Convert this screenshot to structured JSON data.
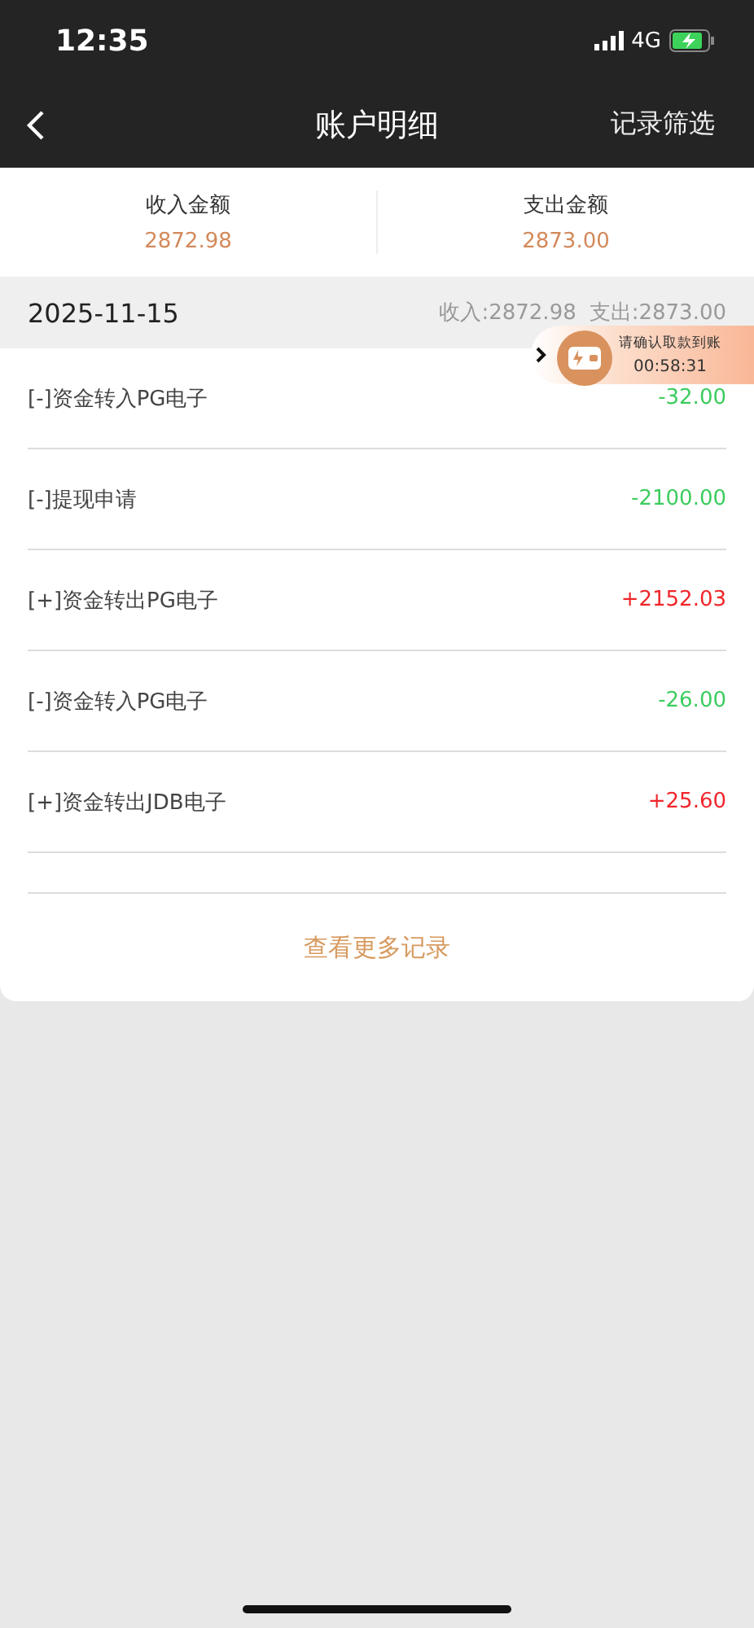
{
  "status_bar": {
    "time": "12:35",
    "network": "4G"
  },
  "nav": {
    "title": "账户明细",
    "action": "记录筛选"
  },
  "summary": [
    {
      "label": "收入金额",
      "value": "2872.98"
    },
    {
      "label": "支出金额",
      "value": "2873.00"
    }
  ],
  "day": {
    "date": "2025-11-15",
    "income": "收入:2872.98",
    "expense": "支出:2873.00"
  },
  "records": [
    {
      "title": "[-]资金转入PG电子",
      "amount": "-32.00",
      "kind": "expense"
    },
    {
      "title": "[-]提现申请",
      "amount": "-2100.00",
      "kind": "expense"
    },
    {
      "title": "[+]资金转出PG电子",
      "amount": "+2152.03",
      "kind": "income"
    },
    {
      "title": "[-]资金转入PG电子",
      "amount": "-26.00",
      "kind": "expense"
    },
    {
      "title": "[+]资金转出JDB电子",
      "amount": "+25.60",
      "kind": "income"
    }
  ],
  "more_link": "查看更多记录",
  "floating_notice": {
    "text": "请确认取款到账",
    "countdown": "00:58:31"
  }
}
